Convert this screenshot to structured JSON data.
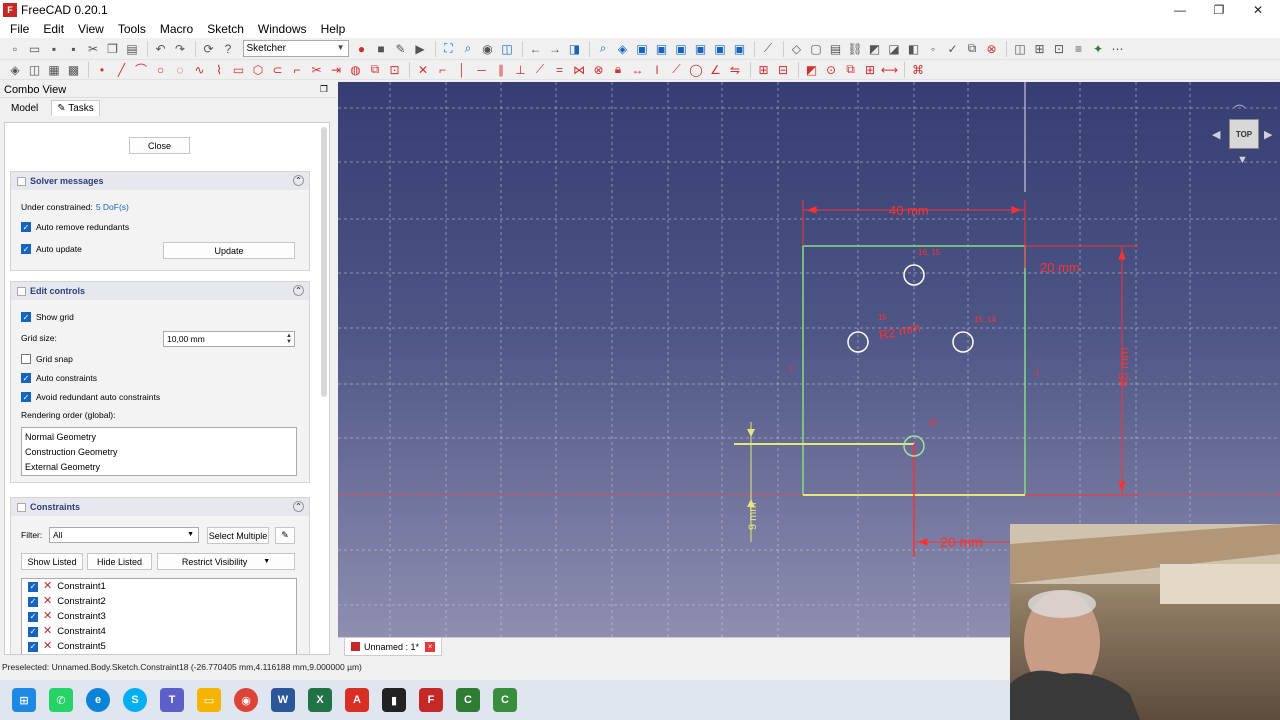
{
  "window": {
    "title": "FreeCAD 0.20.1",
    "controls": [
      "—",
      "❐",
      "✕"
    ]
  },
  "menu": [
    "File",
    "Edit",
    "View",
    "Tools",
    "Macro",
    "Sketch",
    "Windows",
    "Help"
  ],
  "toolbar": {
    "workbench": "Sketcher"
  },
  "combo": {
    "title": "Combo View",
    "tabs": [
      "Model",
      "Tasks"
    ],
    "close_label": "Close",
    "solver": {
      "title": "Solver messages",
      "under_constrained": "Under constrained:",
      "dofs": "5 DoF(s)",
      "auto_remove": "Auto remove redundants",
      "auto_update": "Auto update",
      "update_label": "Update"
    },
    "edit": {
      "title": "Edit controls",
      "show_grid": "Show grid",
      "grid_size_label": "Grid size:",
      "grid_size_value": "10,00 mm",
      "grid_snap": "Grid snap",
      "auto_constraints": "Auto constraints",
      "avoid_redundant": "Avoid redundant auto constraints",
      "rendering_order": "Rendering order (global):",
      "order_items": [
        "Normal Geometry",
        "Construction Geometry",
        "External Geometry"
      ]
    },
    "constraints": {
      "title": "Constraints",
      "filter_label": "Filter:",
      "filter_value": "All",
      "select_multiple": "Select Multiple",
      "show_listed": "Show Listed",
      "hide_listed": "Hide Listed",
      "restrict_visibility": "Restrict Visibility",
      "items": [
        "Constraint1",
        "Constraint2",
        "Constraint3",
        "Constraint4",
        "Constraint5"
      ]
    }
  },
  "sketch": {
    "dim_top": "40 mm",
    "dim_right_top": "20 mm",
    "dim_right_height": "45 mm",
    "dim_bottom": "20 mm",
    "dim_radius": "R2 mm",
    "dim_left_small": "9 mm",
    "tags": [
      "16, 15",
      "15",
      "15, 14",
      "14"
    ]
  },
  "navcube": {
    "face": "TOP"
  },
  "document_tab": "Unnamed : 1*",
  "status": "Preselected: Unnamed.Body.Sketch.Constraint18 (-26.770405 mm,4.116188 mm,9.000000 µm)",
  "taskbar": [
    "Start",
    "WhatsApp",
    "Edge",
    "Skype",
    "Teams",
    "Explorer",
    "Chrome",
    "Word",
    "Excel",
    "Acrobat",
    "Terminal",
    "FreeCAD",
    "Camtasia",
    "Camtasia Recorder"
  ]
}
